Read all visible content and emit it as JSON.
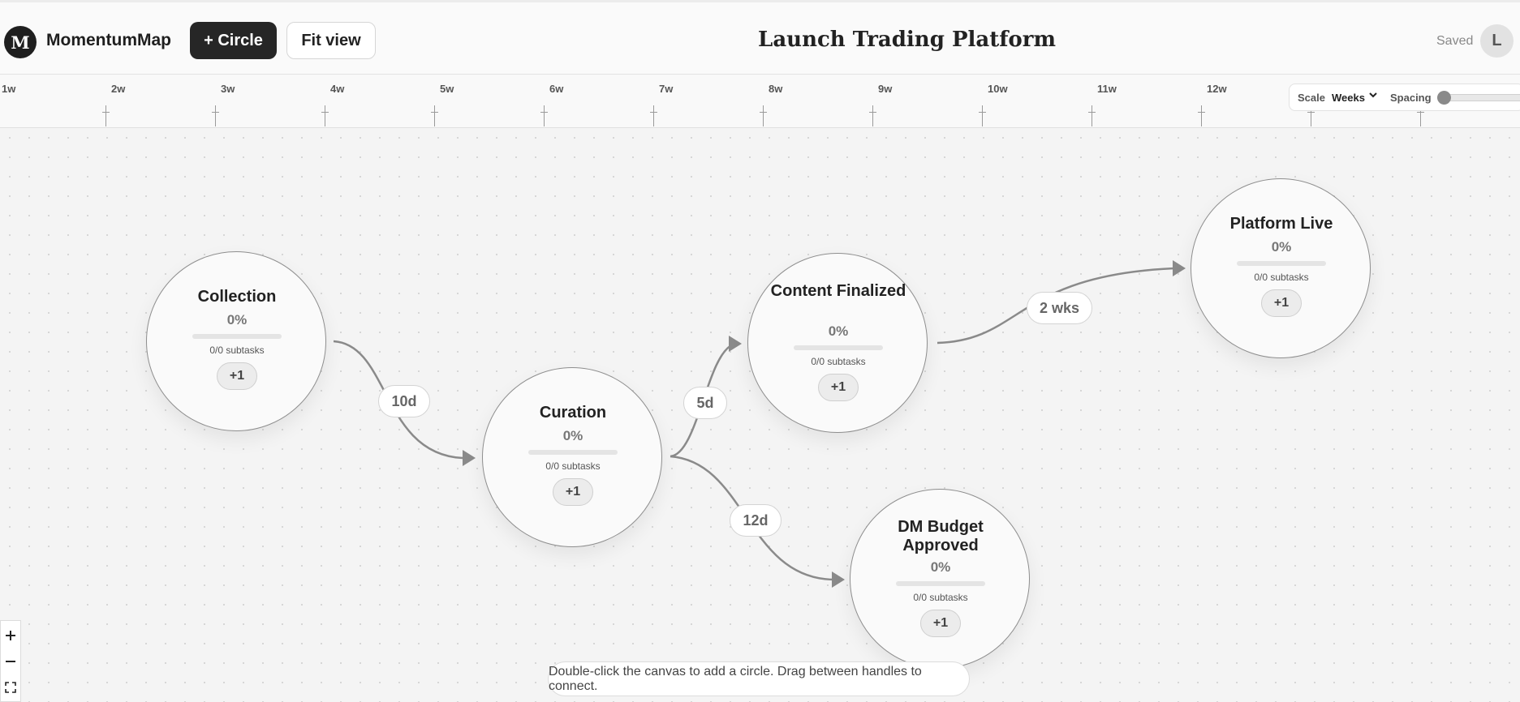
{
  "app": {
    "logo_letter": "M",
    "name": "MomentumMap"
  },
  "toolbar": {
    "add_circle_label": "+ Circle",
    "fit_view_label": "Fit view"
  },
  "board": {
    "title": "Launch Trading Platform",
    "save_status": "Saved"
  },
  "user": {
    "avatar_initial": "L"
  },
  "timeline": {
    "ticks": [
      "1w",
      "2w",
      "3w",
      "4w",
      "5w",
      "6w",
      "7w",
      "8w",
      "9w",
      "10w",
      "11w",
      "12w"
    ],
    "scale_label": "Scale",
    "scale_value": "Weeks",
    "spacing_label": "Spacing",
    "spacing_level": 0
  },
  "nodes": [
    {
      "title": "Collection",
      "percent": "0%",
      "progress": 0,
      "subtasks": "0/0 subtasks",
      "add": "+1"
    },
    {
      "title": "Curation",
      "percent": "0%",
      "progress": 0,
      "subtasks": "0/0 subtasks",
      "add": "+1"
    },
    {
      "title": "Content Finalized",
      "percent": "0%",
      "progress": 0,
      "subtasks": "0/0 subtasks",
      "add": "+1"
    },
    {
      "title": "DM Budget Approved",
      "percent": "0%",
      "progress": 0,
      "subtasks": "0/0 subtasks",
      "add": "+1"
    },
    {
      "title": "Platform Live",
      "percent": "0%",
      "progress": 0,
      "subtasks": "0/0 subtasks",
      "add": "+1"
    }
  ],
  "edges": [
    {
      "from": "Collection",
      "to": "Curation",
      "label": "10d"
    },
    {
      "from": "Curation",
      "to": "Content Finalized",
      "label": "5d"
    },
    {
      "from": "Curation",
      "to": "DM Budget Approved",
      "label": "12d"
    },
    {
      "from": "Content Finalized",
      "to": "Platform Live",
      "label": "2 wks"
    }
  ],
  "zoom": {
    "zoom_in_icon": "plus-icon",
    "zoom_out_icon": "minus-icon",
    "fit_icon": "fullscreen-icon"
  },
  "hint": "Double-click the canvas to add a circle. Drag between handles to connect.",
  "colors": {
    "node_border": "#8e8e8e",
    "edge": "#8a8a8a",
    "primary_button": "#262626"
  }
}
